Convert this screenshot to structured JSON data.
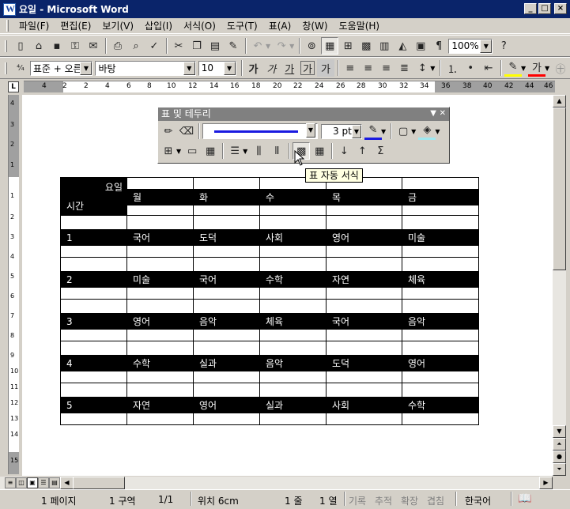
{
  "window": {
    "title": "요일 - Microsoft Word",
    "buttons": [
      "_",
      "□",
      "×"
    ]
  },
  "menu": [
    "파일(F)",
    "편집(E)",
    "보기(V)",
    "삽입(I)",
    "서식(O)",
    "도구(T)",
    "표(A)",
    "창(W)",
    "도움말(H)"
  ],
  "standard_toolbar": {
    "zoom": "100%",
    "help": "?"
  },
  "format_toolbar": {
    "style": "표준 + 오른·",
    "font": "바탕",
    "size": "10",
    "glyphs": [
      "가",
      "가",
      "가",
      "가",
      "가"
    ]
  },
  "ruler": {
    "labels": [
      "4",
      "2",
      "2",
      "4",
      "6",
      "8",
      "10",
      "12",
      "14",
      "16",
      "18",
      "20",
      "22",
      "24",
      "26",
      "28",
      "30",
      "32",
      "34",
      "36",
      "38",
      "40",
      "42",
      "44",
      "46"
    ],
    "vlabels": [
      "4",
      "3",
      "2",
      "1",
      "1",
      "2",
      "3",
      "4",
      "5",
      "6",
      "7",
      "8",
      "9",
      "10",
      "11",
      "12",
      "13",
      "14",
      "15"
    ],
    "tab_marker": "L"
  },
  "floating_toolbar": {
    "title": "표 및 테두리",
    "line_weight": "3 pt",
    "sum": "Σ"
  },
  "tooltip": "표 자동 서식",
  "table": {
    "corner_top": "요일",
    "corner_bottom": "시간",
    "days": [
      "월",
      "화",
      "수",
      "목",
      "금"
    ],
    "rows": [
      {
        "period": "1",
        "subjects": [
          "국어",
          "도덕",
          "사회",
          "영어",
          "미술"
        ]
      },
      {
        "period": "2",
        "subjects": [
          "미술",
          "국어",
          "수학",
          "자연",
          "체육"
        ]
      },
      {
        "period": "3",
        "subjects": [
          "영어",
          "음악",
          "체육",
          "국어",
          "음악"
        ]
      },
      {
        "period": "4",
        "subjects": [
          "수학",
          "실과",
          "음악",
          "도덕",
          "영어"
        ]
      },
      {
        "period": "5",
        "subjects": [
          "자연",
          "영어",
          "실과",
          "사회",
          "수학"
        ]
      }
    ]
  },
  "status": {
    "page": "1 페이지",
    "section": "1 구역",
    "pages": "1/1",
    "position": "위치 6cm",
    "line": "1 줄",
    "column": "1 열",
    "rec": "기록",
    "trk": "추적",
    "ext": "확장",
    "ovr": "겹침",
    "language": "한국어"
  }
}
